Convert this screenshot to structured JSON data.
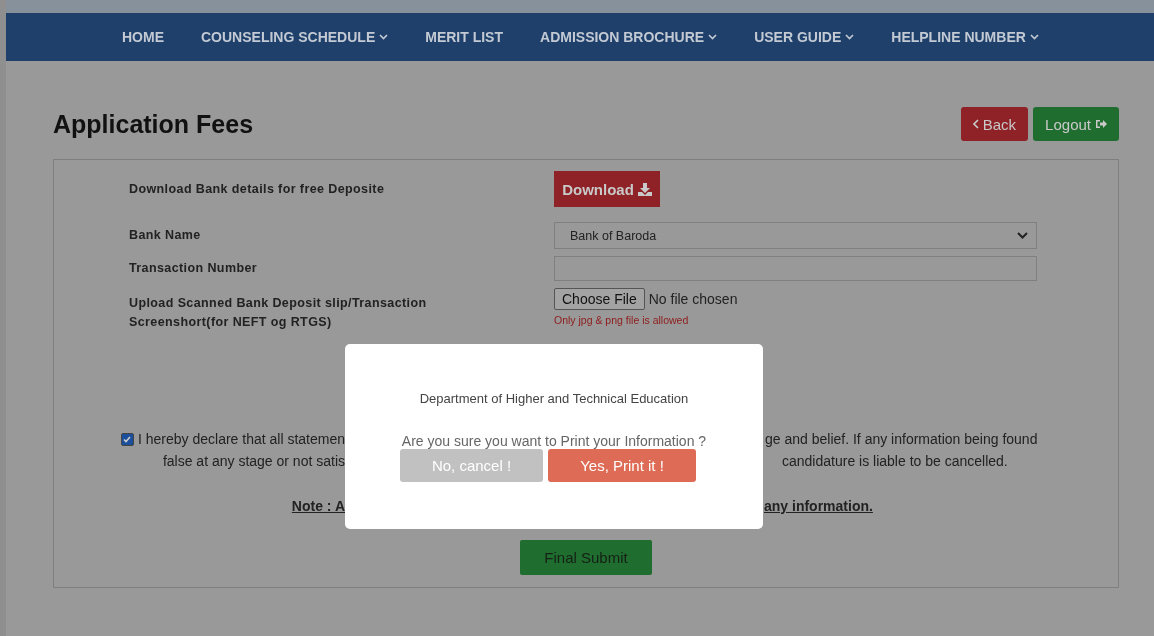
{
  "nav": [
    {
      "label": "HOME",
      "dropdown": false
    },
    {
      "label": "COUNSELING SCHEDULE",
      "dropdown": true
    },
    {
      "label": "MERIT LIST",
      "dropdown": false
    },
    {
      "label": "ADMISSION BROCHURE",
      "dropdown": true
    },
    {
      "label": "USER GUIDE",
      "dropdown": true
    },
    {
      "label": "HELPLINE NUMBER",
      "dropdown": true
    }
  ],
  "title": "Application Fees",
  "back_button": "Back",
  "logout_button": "Logout",
  "form": {
    "download_label": "Download Bank details for free Deposite",
    "download_button": "Download",
    "bank_label": "Bank Name",
    "bank_value": "Bank of Baroda",
    "transaction_label": "Transaction Number",
    "upload_label": "Upload Scanned Bank Deposit slip/Transaction Screenshort(for NEFT og RTGS)",
    "choose_file": "Choose File",
    "no_file": "No file chosen",
    "upload_hint": "Only jpg & png file is allowed"
  },
  "declaration": {
    "checked": true,
    "line1_left": "I hereby declare that all statemen",
    "line1_right": "ge and belief. If any information being found",
    "line2_left": "false at any stage or not satis",
    "line2_right": "candidature is liable to be cancelled.",
    "note_left": "Note : A",
    "note_right": "any information."
  },
  "final_submit": "Final Submit",
  "modal": {
    "heading": "Department of Higher and Technical Education",
    "question": "Are you sure you want to Print your Information ?",
    "cancel": "No, cancel !",
    "confirm": "Yes, Print it !"
  }
}
